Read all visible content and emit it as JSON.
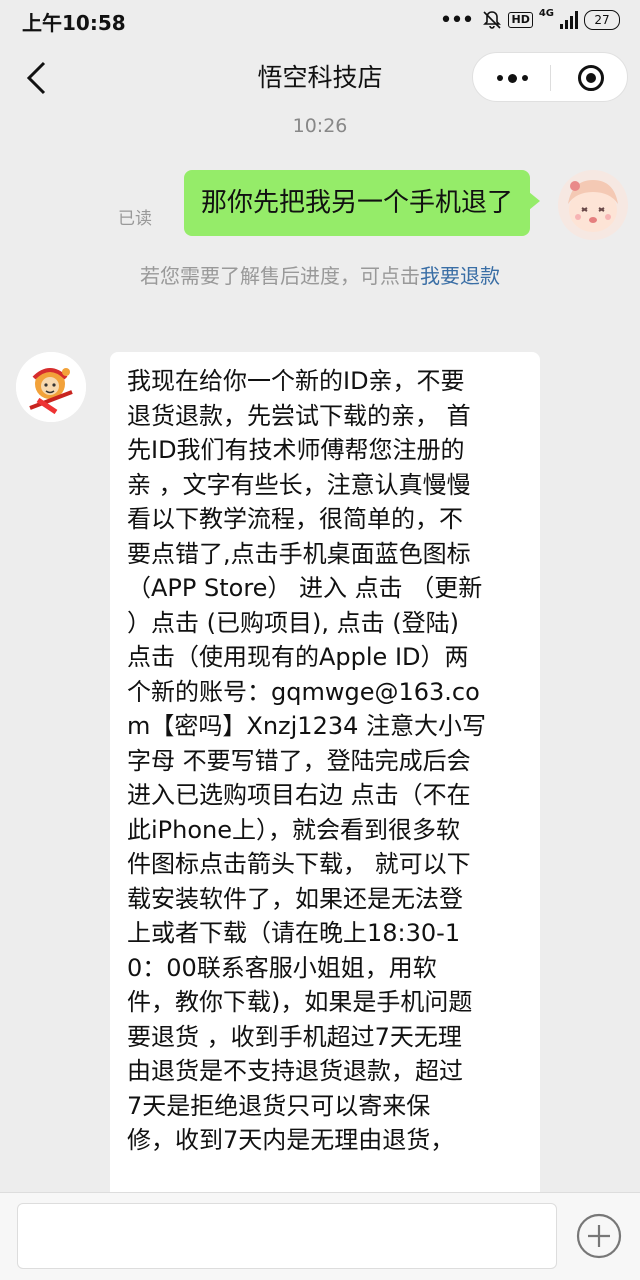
{
  "status_bar": {
    "time": "上午10:58",
    "network": "4G",
    "battery": "27"
  },
  "nav": {
    "title": "悟空科技店"
  },
  "chat": {
    "timestamp": "10:26",
    "sent_message": {
      "read_status": "已读",
      "text": "那你先把我另一个手机退了"
    },
    "system_note": {
      "text": "若您需要了解售后进度，可点击",
      "link": "我要退款"
    },
    "received_message": {
      "lines": [
        "我现在给你一个新的ID亲，不要",
        "退货退款，先尝试下载的亲，  首",
        "先ID我们有技术师傅帮您注册的",
        "亲 ，文字有些长，注意认真慢慢",
        "看以下教学流程，很简单的，不",
        "要点错了,点击手机桌面蓝色图标",
        "（APP Store） 进入 点击 （更新",
        "）点击 (已购项目), 点击 (登陆)",
        "点击（使用现有的Apple ID）两",
        "个新的账号：gqmwge@163.co",
        "m【密吗】Xnzj1234 注意大小写",
        "字母 不要写错了，登陆完成后会",
        "进入已选购项目右边 点击（不在",
        "此iPhone上），就会看到很多软",
        "件图标点击箭头下载， 就可以下",
        "载安装软件了，如果还是无法登",
        "上或者下载（请在晚上18:30-1",
        "0：00联系客服小姐姐，用软",
        "件，教你下载)，如果是手机问题",
        "要退货 ，收到手机超过7天无理",
        "由退货是不支持退货退款，超过",
        "7天是拒绝退货只可以寄来保",
        "修，收到7天内是无理由退货，"
      ]
    }
  },
  "input": {
    "placeholder": ""
  }
}
